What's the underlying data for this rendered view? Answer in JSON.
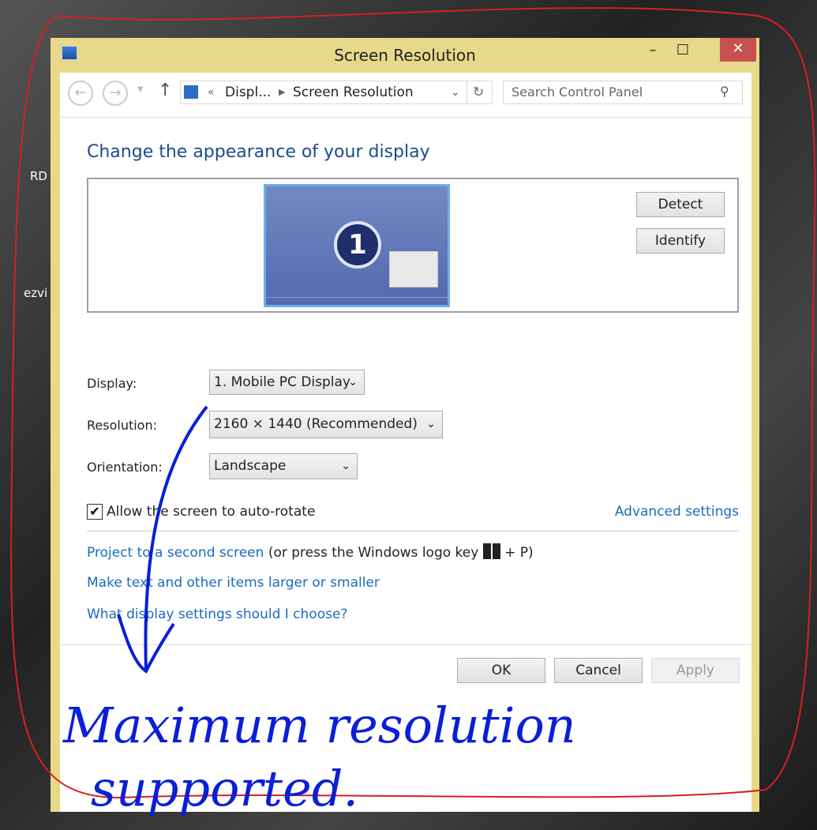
{
  "window": {
    "title": "Screen Resolution",
    "minimize": "–",
    "maximize": "☐",
    "close": "✕"
  },
  "addressbar": {
    "prefix": "«",
    "crumb1": "Displ...",
    "crumb2": "Screen Resolution",
    "search_placeholder": "Search Control Panel"
  },
  "heading": "Change the appearance of your display",
  "monitor": {
    "number": "1"
  },
  "buttons": {
    "detect": "Detect",
    "identify": "Identify",
    "ok": "OK",
    "cancel": "Cancel",
    "apply": "Apply"
  },
  "fields": {
    "display": {
      "label": "Display:",
      "value": "1. Mobile PC Display"
    },
    "resolution": {
      "label": "Resolution:",
      "value": "2160 × 1440 (Recommended)"
    },
    "orientation": {
      "label": "Orientation:",
      "value": "Landscape"
    }
  },
  "autorotate": {
    "label": "Allow the screen to auto-rotate",
    "checked": true
  },
  "links": {
    "advanced": "Advanced settings",
    "project": "Project to a second screen",
    "project_hint": "(or press the Windows logo key",
    "project_hint_end": "+ P)",
    "text_size": "Make text and other items larger or smaller",
    "help": "What display settings should I choose?"
  },
  "desktop": {
    "icon1": "RD",
    "icon2": "ezvi"
  },
  "annotation": {
    "line1": "Maximum resolution",
    "line2": "supported.",
    "color": "#0a1fd6"
  }
}
